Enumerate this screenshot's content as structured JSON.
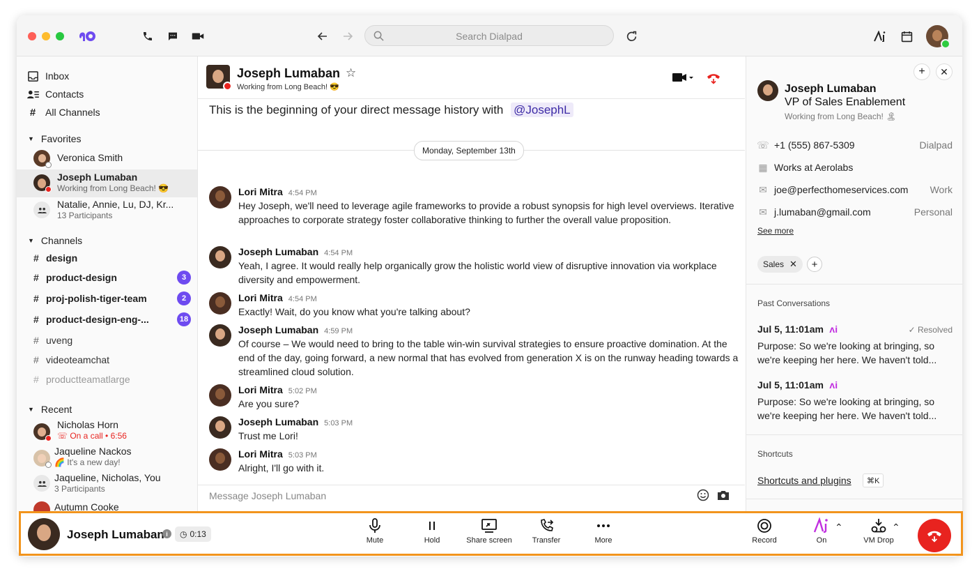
{
  "titlebar": {
    "search_placeholder": "Search Dialpad"
  },
  "sidebar": {
    "nav": [
      {
        "label": "Inbox",
        "icon": "inbox-icon"
      },
      {
        "label": "Contacts",
        "icon": "contacts-icon"
      },
      {
        "label": "All Channels",
        "icon": "hash-icon"
      }
    ],
    "favorites_header": "Favorites",
    "favorites": [
      {
        "name": "Veronica Smith",
        "sub": ""
      },
      {
        "name": "Joseph Lumaban",
        "sub": "Working from Long Beach! 😎"
      },
      {
        "name": "Natalie, Annie, Lu, DJ, Kr...",
        "sub": "13 Participants"
      }
    ],
    "channels_header": "Channels",
    "channels": [
      {
        "name": "design",
        "badge": ""
      },
      {
        "name": "product-design",
        "badge": "3"
      },
      {
        "name": "proj-polish-tiger-team",
        "badge": "2"
      },
      {
        "name": "product-design-eng-...",
        "badge": "18"
      },
      {
        "name": "uveng",
        "badge": ""
      },
      {
        "name": "videoteamchat",
        "badge": ""
      },
      {
        "name": "productteamatlarge",
        "badge": ""
      }
    ],
    "recent_header": "Recent",
    "recent": [
      {
        "name": "Nicholas Horn",
        "sub": "On a call • 6:56"
      },
      {
        "name": "Jaqueline Nackos",
        "sub": "🌈 It's a new day!"
      },
      {
        "name": "Jaqueline, Nicholas, You",
        "sub": "3 Participants"
      },
      {
        "name": "Autumn Cooke",
        "sub": ""
      }
    ]
  },
  "chat": {
    "contact_name": "Joseph Lumaban",
    "contact_status": "Working from Long Beach! 😎",
    "intro_text": "This is the beginning of your direct message history with",
    "intro_mention": "@JosephL",
    "date_divider": "Monday, September 13th",
    "messages": [
      {
        "author": "Lori Mitra",
        "time": "4:54 PM",
        "text": "Hey Joseph, we'll need to leverage agile frameworks to provide a robust synopsis for high level overviews. Iterative approaches to corporate strategy foster collaborative thinking to further the overall value proposition."
      },
      {
        "author": "Joseph Lumaban",
        "time": "4:54 PM",
        "text": "Yeah, I agree. It would really help organically grow the holistic world view of disruptive innovation via workplace diversity and empowerment."
      },
      {
        "author": "Lori Mitra",
        "time": "4:54 PM",
        "text": "Exactly! Wait, do you know what you're talking about?"
      },
      {
        "author": "Joseph Lumaban",
        "time": "4:59 PM",
        "text": "Of course – We would need to bring to the table win-win survival strategies to ensure proactive domination. At the end of the day, going forward, a new normal that has evolved from generation X is on the runway heading towards a streamlined cloud solution."
      },
      {
        "author": "Lori Mitra",
        "time": "5:02 PM",
        "text": "Are you sure?"
      },
      {
        "author": "Joseph Lumaban",
        "time": "5:03 PM",
        "text": "Trust me Lori!"
      },
      {
        "author": "Lori Mitra",
        "time": "5:03 PM",
        "text": "Alright, I'll go with it."
      }
    ],
    "composer_placeholder": "Message Joseph Lumaban"
  },
  "profile": {
    "name": "Joseph Lumaban",
    "title": "VP of Sales Enablement",
    "status": "Working from Long Beach! 🏝",
    "phone": "+1 (555) 867-5309",
    "phone_tag": "Dialpad",
    "company": "Works at Aerolabs",
    "email_work": "joe@perfecthomeservices.com",
    "email_work_tag": "Work",
    "email_personal": "j.lumaban@gmail.com",
    "email_personal_tag": "Personal",
    "see_more": "See more",
    "tag": "Sales",
    "past_header": "Past Conversations",
    "past": [
      {
        "date": "Jul 5, 11:01am",
        "status": "Resolved",
        "text": "Purpose: So we're looking at bringing, so we're keeping her here. We haven't told..."
      },
      {
        "date": "Jul 5, 11:01am",
        "status": "",
        "text": "Purpose: So we're looking at bringing, so we're keeping her here. We haven't told..."
      }
    ],
    "shortcuts_header": "Shortcuts",
    "shortcuts_link": "Shortcuts and plugins",
    "shortcuts_key": "⌘K"
  },
  "callbar": {
    "name": "Joseph Lumaban",
    "timer": "0:13",
    "buttons": [
      {
        "label": "Mute"
      },
      {
        "label": "Hold"
      },
      {
        "label": "Share screen"
      },
      {
        "label": "Transfer"
      },
      {
        "label": "More"
      }
    ],
    "right_buttons": [
      {
        "label": "Record"
      },
      {
        "label": "On"
      },
      {
        "label": "VM Drop"
      }
    ],
    "colors": {
      "accent": "#6e4bf0",
      "hangup": "#e8231f",
      "highlight": "#f2941d",
      "ai": "#c12fe0"
    }
  }
}
